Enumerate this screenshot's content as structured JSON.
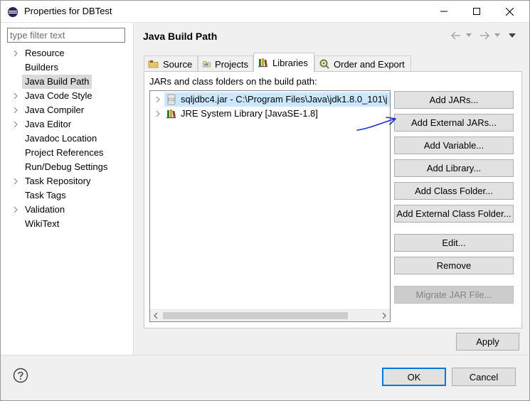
{
  "window": {
    "title": "Properties for DBTest"
  },
  "filter": {
    "placeholder": "type filter text"
  },
  "nav": {
    "items": [
      {
        "label": "Resource",
        "expandable": true
      },
      {
        "label": "Builders",
        "expandable": false
      },
      {
        "label": "Java Build Path",
        "expandable": false,
        "selected": true
      },
      {
        "label": "Java Code Style",
        "expandable": true
      },
      {
        "label": "Java Compiler",
        "expandable": true
      },
      {
        "label": "Java Editor",
        "expandable": true
      },
      {
        "label": "Javadoc Location",
        "expandable": false
      },
      {
        "label": "Project References",
        "expandable": false
      },
      {
        "label": "Run/Debug Settings",
        "expandable": false
      },
      {
        "label": "Task Repository",
        "expandable": true
      },
      {
        "label": "Task Tags",
        "expandable": false
      },
      {
        "label": "Validation",
        "expandable": true
      },
      {
        "label": "WikiText",
        "expandable": false
      }
    ]
  },
  "page": {
    "title": "Java Build Path"
  },
  "tabs": [
    {
      "label": "Source",
      "icon": "source-folder-icon"
    },
    {
      "label": "Projects",
      "icon": "projects-icon"
    },
    {
      "label": "Libraries",
      "icon": "libraries-icon",
      "active": true
    },
    {
      "label": "Order and Export",
      "icon": "order-export-icon"
    }
  ],
  "libraries": {
    "section_label": "JARs and class folders on the build path:",
    "entries": [
      {
        "label": "sqljdbc4.jar - C:\\Program Files\\Java\\jdk1.8.0_101\\j",
        "icon": "jar-icon",
        "selected": true
      },
      {
        "label": "JRE System Library [JavaSE-1.8]",
        "icon": "library-icon",
        "selected": false
      }
    ],
    "buttons": [
      {
        "label": "Add JARs...",
        "enabled": true
      },
      {
        "label": "Add External JARs...",
        "enabled": true
      },
      {
        "label": "Add Variable...",
        "enabled": true
      },
      {
        "label": "Add Library...",
        "enabled": true
      },
      {
        "label": "Add Class Folder...",
        "enabled": true
      },
      {
        "label": "Add External Class Folder...",
        "enabled": true
      },
      {
        "label": "Edit...",
        "enabled": true
      },
      {
        "label": "Remove",
        "enabled": true
      },
      {
        "label": "Migrate JAR File...",
        "enabled": false
      }
    ]
  },
  "actions": {
    "apply": "Apply",
    "ok": "OK",
    "cancel": "Cancel"
  },
  "colors": {
    "selection": "#cce8ff",
    "nav_selection": "#d9d9d9",
    "default_border": "#0078d7",
    "annotation": "#1a2fd8"
  }
}
